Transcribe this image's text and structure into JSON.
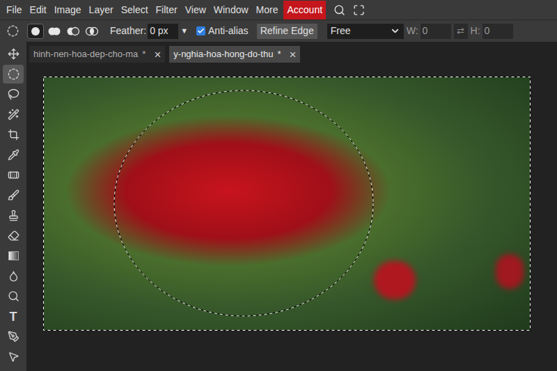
{
  "menu": {
    "items": [
      "File",
      "Edit",
      "Image",
      "Layer",
      "Select",
      "Filter",
      "View",
      "Window",
      "More"
    ],
    "account": "Account"
  },
  "options": {
    "modes": [
      {
        "kind": "new",
        "selected": true
      },
      {
        "kind": "add",
        "selected": false
      },
      {
        "kind": "subtract",
        "selected": false
      },
      {
        "kind": "intersect",
        "selected": false
      }
    ],
    "feather": {
      "label": "Feather:",
      "value": "0 px",
      "arrow": "▼"
    },
    "anti_alias": {
      "label": "Anti-alias",
      "checked": true
    },
    "refine_edge": "Refine Edge",
    "style": {
      "value": "Free"
    },
    "width": {
      "label": "W:",
      "value": "0"
    },
    "swap": "⇄",
    "height": {
      "label": "H:",
      "value": "0"
    }
  },
  "tools": [
    {
      "kind": "move",
      "selected": false
    },
    {
      "kind": "ellipse-select",
      "selected": true
    },
    {
      "kind": "lasso",
      "selected": false
    },
    {
      "kind": "magic-wand",
      "selected": false
    },
    {
      "kind": "crop",
      "selected": false
    },
    {
      "kind": "eyedropper",
      "selected": false
    },
    {
      "kind": "healing",
      "selected": false
    },
    {
      "kind": "brush",
      "selected": false
    },
    {
      "kind": "stamp",
      "selected": false
    },
    {
      "kind": "eraser",
      "selected": false
    },
    {
      "kind": "gradient",
      "selected": false
    },
    {
      "kind": "blur",
      "selected": false
    },
    {
      "kind": "dodge",
      "selected": false
    },
    {
      "kind": "text",
      "glyph": "T",
      "selected": false
    },
    {
      "kind": "pen",
      "selected": false
    },
    {
      "kind": "path-select",
      "selected": false
    }
  ],
  "tabs": [
    {
      "label": "hinh-nen-hoa-dep-cho-ma",
      "modified": "*",
      "close": "×",
      "selected": false
    },
    {
      "label": "y-nghia-hoa-hong-do-thu",
      "modified": "*",
      "close": "×",
      "selected": true
    }
  ]
}
